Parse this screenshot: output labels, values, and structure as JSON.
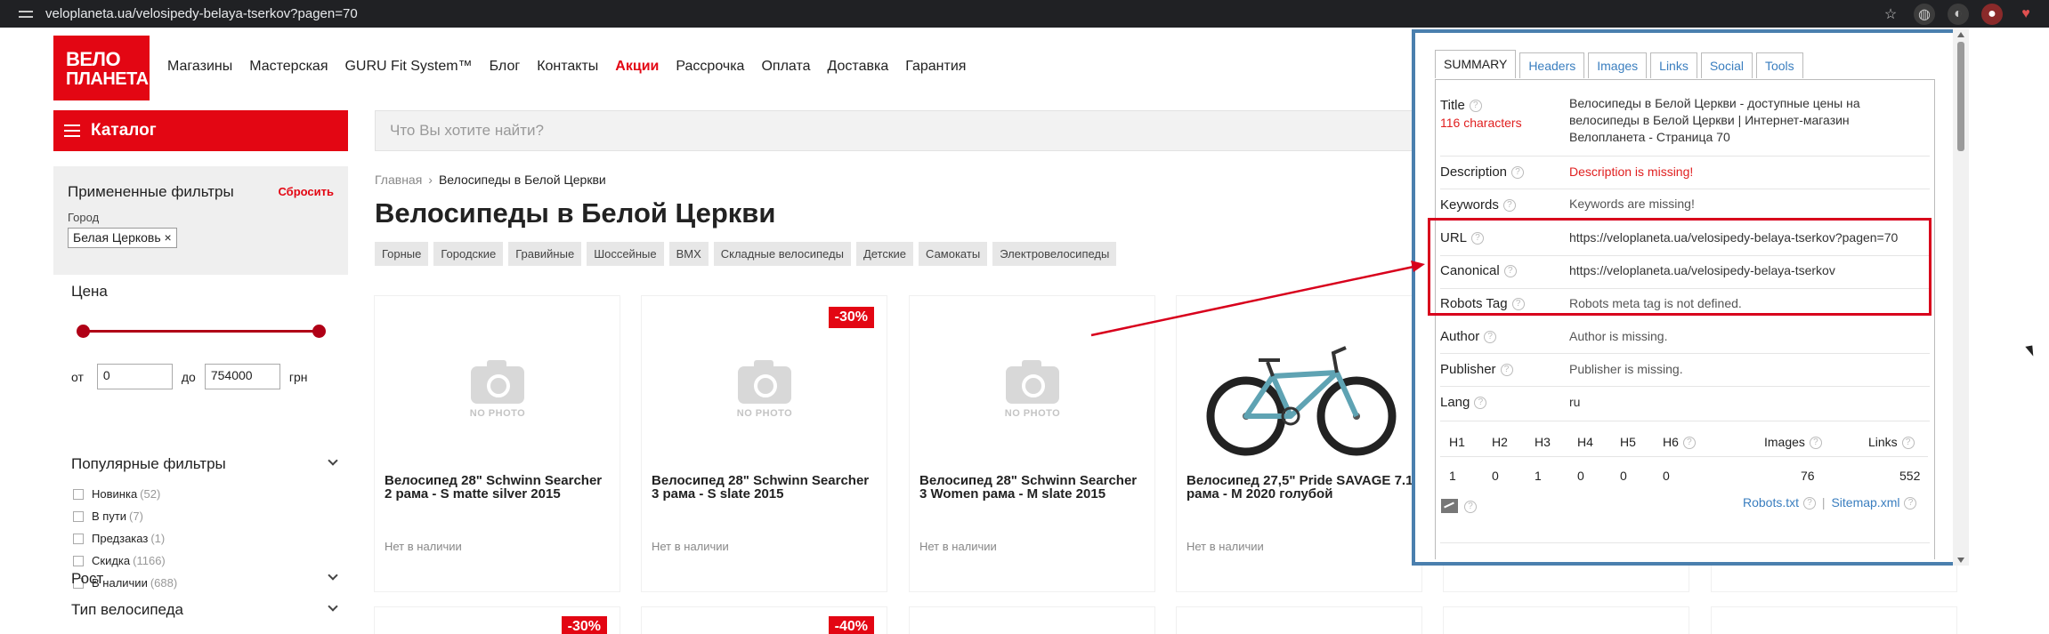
{
  "browser": {
    "url": "veloplaneta.ua/velosipedy-belaya-tserkov?pagen=70",
    "ext_badge": "1"
  },
  "site": {
    "logo_line1": "ВЕЛО",
    "logo_line2": "ПЛАНЕТА",
    "nav": [
      "Магазины",
      "Мастерская",
      "GURU Fit System™",
      "Блог",
      "Контакты",
      "Акции",
      "Рассрочка",
      "Оплата",
      "Доставка",
      "Гарантия"
    ],
    "catalog_label": "Каталог",
    "search_placeholder": "Что Вы хотите найти?"
  },
  "sidebar": {
    "applied_title": "Примененные фильтры",
    "reset": "Сбросить",
    "city_label": "Город",
    "city_chip": "Белая Церковь ×",
    "price_title": "Цена",
    "from_label": "от",
    "from_value": "0",
    "to_label": "до",
    "to_value": "754000",
    "currency": "грн",
    "popular_title": "Популярные фильтры",
    "checks": [
      {
        "label": "Новинка",
        "count": "(52)"
      },
      {
        "label": "В пути",
        "count": "(7)"
      },
      {
        "label": "Предзаказ",
        "count": "(1)"
      },
      {
        "label": "Скидка",
        "count": "(1166)"
      },
      {
        "label": "В наличии",
        "count": "(688)"
      }
    ],
    "growth_title": "Рост",
    "type_title": "Тип велосипеда"
  },
  "main": {
    "breadcrumb_home": "Главная",
    "breadcrumb_current": "Велосипеды в Белой Церкви",
    "title": "Велосипеды в Белой Церкви",
    "tags": [
      "Горные",
      "Городские",
      "Гравийные",
      "Шоссейные",
      "BMX",
      "Складные велосипеды",
      "Детские",
      "Самокаты",
      "Электровелосипеды"
    ],
    "nophoto": "NO PHOTO",
    "products": [
      {
        "name": "Велосипед 28\" Schwinn Searcher 2 рама - S matte silver 2015",
        "stock": "Нет в наличии",
        "badge": ""
      },
      {
        "name": "Велосипед 28\" Schwinn Searcher 3 рама - S slate 2015",
        "stock": "Нет в наличии",
        "badge": "-30%"
      },
      {
        "name": "Велосипед 28\" Schwinn Searcher 3 Women рама - M slate 2015",
        "stock": "Нет в наличии",
        "badge": ""
      },
      {
        "name": "Велосипед 27,5\" Pride SAVAGE 7.1 рама - M 2020 голубой",
        "stock": "Нет в наличии",
        "badge": ""
      }
    ],
    "low_badges": [
      "-30%",
      "-40%"
    ]
  },
  "seo": {
    "tabs": [
      "SUMMARY",
      "Headers",
      "Images",
      "Links",
      "Social",
      "Tools"
    ],
    "title_label": "Title",
    "title_chars": "116 characters",
    "title_value": "Велосипеды в Белой Церкви - доступные цены на велосипеды в Белой Церкви | Интернет-магазин Велопланета - Страница 70",
    "description_label": "Description",
    "description_value": "Description is missing!",
    "keywords_label": "Keywords",
    "keywords_value": "Keywords are missing!",
    "url_label": "URL",
    "url_value": "https://veloplaneta.ua/velosipedy-belaya-tserkov?pagen=70",
    "canonical_label": "Canonical",
    "canonical_value": "https://veloplaneta.ua/velosipedy-belaya-tserkov",
    "robots_label": "Robots Tag",
    "robots_value": "Robots meta tag is not defined.",
    "author_label": "Author",
    "author_value": "Author is missing.",
    "publisher_label": "Publisher",
    "publisher_value": "Publisher is missing.",
    "lang_label": "Lang",
    "lang_value": "ru",
    "headers": [
      "H1",
      "H2",
      "H3",
      "H4",
      "H5",
      "H6"
    ],
    "header_counts": [
      "1",
      "0",
      "1",
      "0",
      "0",
      "0"
    ],
    "images_label": "Images",
    "images_value": "76",
    "links_label": "Links",
    "links_value": "552",
    "robots_txt": "Robots.txt",
    "sitemap": "Sitemap.xml",
    "accent": "#d8001c"
  }
}
